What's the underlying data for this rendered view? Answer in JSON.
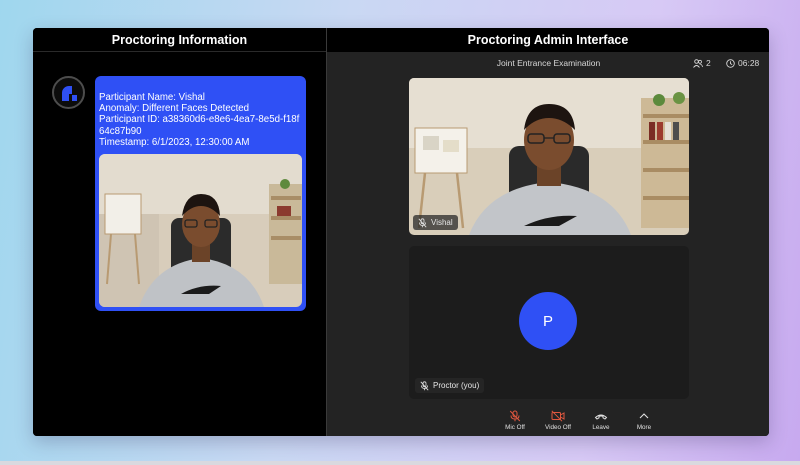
{
  "left_panel": {
    "title": "Proctoring Information",
    "logo_icon": "brand-logo-icon",
    "card": {
      "participant_name": "Participant Name: Vishal",
      "anomaly": "Anomaly: Different Faces Detected",
      "participant_id": "Participant ID: a38360d6-e8e6-4ea7-8e5d-f18f64c87b90",
      "timestamp": "Timestamp: 6/1/2023, 12:30:00 AM",
      "color": "#2f50f5"
    }
  },
  "right_panel": {
    "title": "Proctoring Admin Interface",
    "meeting_title": "Joint Entrance Examination",
    "participant_count": "2",
    "timer": "06:28",
    "participant_tile": {
      "name": "Vishal",
      "mic_icon": "mic-off-icon"
    },
    "proctor_tile": {
      "avatar_letter": "P",
      "name": "Proctor (you)",
      "mic_icon": "mic-off-icon"
    },
    "controls": [
      {
        "label": "Mic Off",
        "icon": "mic-off-icon"
      },
      {
        "label": "Video Off",
        "icon": "video-off-icon"
      },
      {
        "label": "Leave",
        "icon": "phone-hangup-icon"
      },
      {
        "label": "More",
        "icon": "chevron-up-icon"
      }
    ]
  },
  "colors": {
    "accent": "#2f50f5",
    "danger": "#e0573f"
  }
}
